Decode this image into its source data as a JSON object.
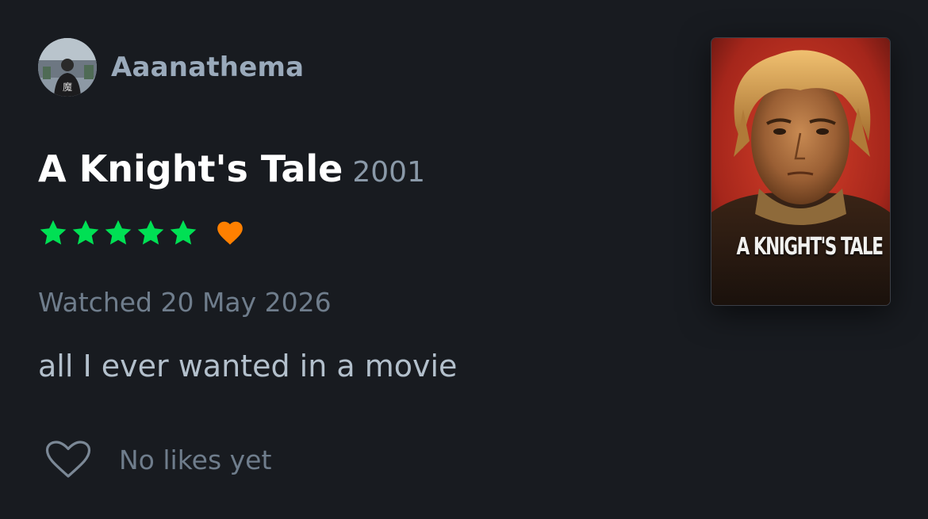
{
  "user": {
    "username": "Aaanathema",
    "avatar_text": "魔"
  },
  "film": {
    "title": "A Knight's Tale",
    "year": "2001",
    "poster_title": "A KNIGHT'S TALE"
  },
  "rating": {
    "stars": 5,
    "max_stars": 5,
    "star_color": "#00e054",
    "liked": true,
    "heart_color": "#ff8000"
  },
  "entry": {
    "watched_text": "Watched 20 May 2026",
    "review_text": "all I ever wanted in a movie"
  },
  "likes": {
    "icon": "heart-outline-icon",
    "text": "No likes yet"
  }
}
